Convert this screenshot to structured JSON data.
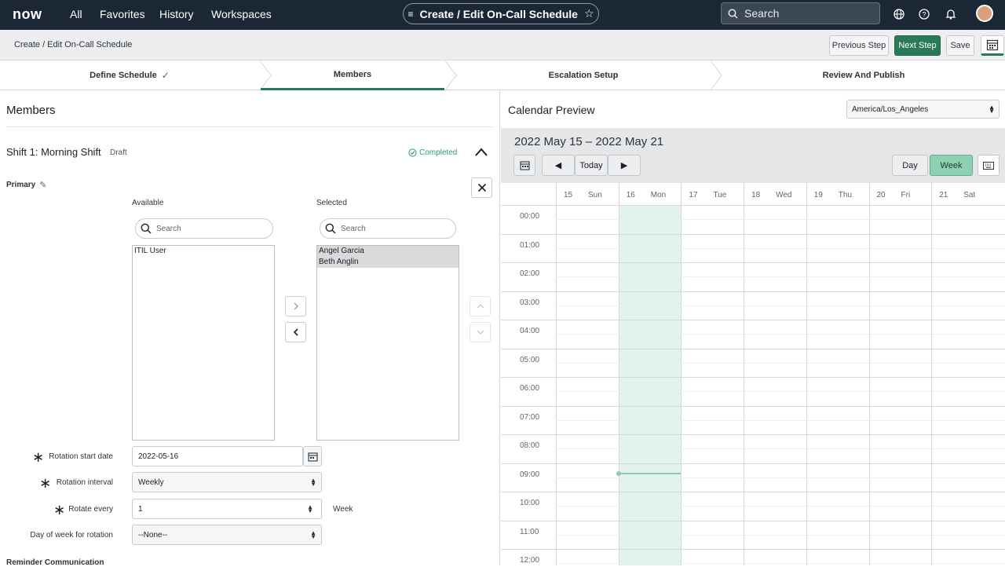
{
  "nav": {
    "logo": "now",
    "links": [
      "All",
      "Favorites",
      "History",
      "Workspaces"
    ],
    "title": "Create / Edit On-Call Schedule",
    "search_placeholder": "Search"
  },
  "breadcrumb": "Create / Edit On-Call Schedule",
  "toolbar": {
    "previous": "Previous Step",
    "next": "Next Step",
    "save": "Save"
  },
  "steps": [
    "Define Schedule",
    "Members",
    "Escalation Setup",
    "Review And Publish"
  ],
  "members": {
    "heading": "Members",
    "shift_title": "Shift 1: Morning Shift",
    "shift_state": "Draft",
    "shift_status": "Completed",
    "primary_label": "Primary",
    "available_label": "Available",
    "selected_label": "Selected",
    "search_placeholder": "Search",
    "available_items": [
      "ITIL User"
    ],
    "selected_items": [
      "Angel Garcia",
      "Beth Anglin"
    ],
    "rotation_start_label": "Rotation start date",
    "rotation_start_value": "2022-05-16",
    "rotation_interval_label": "Rotation interval",
    "rotation_interval_value": "Weekly",
    "rotate_every_label": "Rotate every",
    "rotate_every_value": "1",
    "rotate_every_unit": "Week",
    "day_of_week_label": "Day of week for rotation",
    "day_of_week_value": "--None--",
    "reminder_label": "Reminder Communication"
  },
  "calendar": {
    "title": "Calendar Preview",
    "timezone": "America/Los_Angeles",
    "range": "2022 May 15 – 2022 May 21",
    "today": "Today",
    "view_day": "Day",
    "view_week": "Week",
    "active_view": "Week",
    "days": [
      {
        "num": "15",
        "name": "Sun"
      },
      {
        "num": "16",
        "name": "Mon"
      },
      {
        "num": "17",
        "name": "Tue"
      },
      {
        "num": "18",
        "name": "Wed"
      },
      {
        "num": "19",
        "name": "Thu"
      },
      {
        "num": "20",
        "name": "Fri"
      },
      {
        "num": "21",
        "name": "Sat"
      }
    ],
    "hours": [
      "00:00",
      "01:00",
      "02:00",
      "03:00",
      "04:00",
      "05:00",
      "06:00",
      "07:00",
      "08:00",
      "09:00",
      "10:00",
      "11:00",
      "12:00"
    ],
    "accent": "#2a7a5a",
    "highlight": "#e3f2ec"
  }
}
